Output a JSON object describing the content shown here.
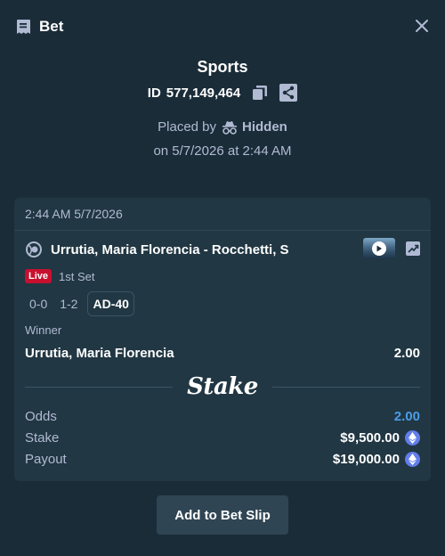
{
  "header": {
    "title": "Bet",
    "icon": "bet-ticket-icon",
    "close_icon": "close-icon"
  },
  "summary": {
    "sport": "Sports",
    "id_label": "ID",
    "id_value": "577,149,464",
    "placed_by_label": "Placed by",
    "placed_by_user": "Hidden",
    "date_text": "on 5/7/2026 at 2:44 AM"
  },
  "bet": {
    "timestamp": "2:44 AM 5/7/2026",
    "event_name": "Urrutia, Maria Florencia - Rocchetti, S",
    "live_label": "Live",
    "period": "1st Set",
    "scores": [
      "0-0",
      "1-2",
      "AD-40"
    ],
    "market": "Winner",
    "selection": "Urrutia, Maria Florencia",
    "selection_odds": "2.00",
    "brand": "Stake",
    "odds_label": "Odds",
    "odds_value": "2.00",
    "stake_label": "Stake",
    "stake_value": "$9,500.00",
    "payout_label": "Payout",
    "payout_value": "$19,000.00"
  },
  "actions": {
    "add_to_slip": "Add to Bet Slip"
  },
  "colors": {
    "background": "#1a2c38",
    "card": "#213743",
    "accent_blue": "#4a9de9",
    "live_red": "#c8102e",
    "muted_text": "#b1bad3"
  }
}
